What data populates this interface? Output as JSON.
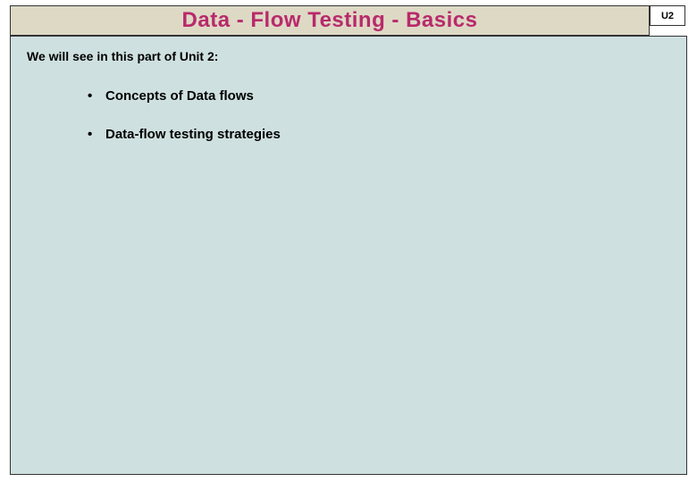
{
  "title": "Data - Flow Testing   -  Basics",
  "unit_badge": "U2",
  "intro": "We will see in this part of Unit 2:",
  "bullets": [
    "Concepts of Data flows",
    "Data-flow testing strategies"
  ]
}
